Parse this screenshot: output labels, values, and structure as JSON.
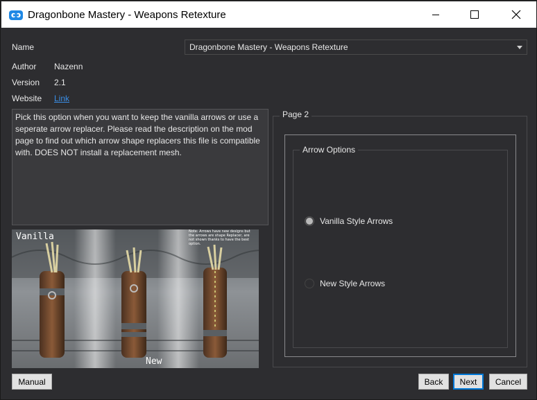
{
  "window": {
    "title": "Dragonbone Mastery - Weapons Retexture",
    "controls": [
      "minimize-icon",
      "maximize-icon",
      "close-icon"
    ]
  },
  "info": {
    "name_label": "Name",
    "name_value": "Dragonbone Mastery - Weapons Retexture",
    "author_label": "Author",
    "author_value": "Nazenn",
    "version_label": "Version",
    "version_value": "2.1",
    "website_label": "Website",
    "website_link": "Link"
  },
  "description": "Pick this option when you want to keep the vanilla arrows or use a seperate arrow replacer. Please read the description on the mod page to find out which arrow shape replacers this file is compatible with. DOES NOT install a replacement mesh.",
  "preview": {
    "label_vanilla": "Vanilla",
    "label_new": "New",
    "note": "Note: Arrows have new designs but the arrows are shape Replacer, are not shown thanks to have the best option."
  },
  "page": {
    "title": "Page 2",
    "group_title": "Arrow Options",
    "options": [
      {
        "label": "Vanilla Style Arrows",
        "selected": true
      },
      {
        "label": "New Style Arrows",
        "selected": false
      }
    ]
  },
  "buttons": {
    "manual": "Manual",
    "back": "Back",
    "next": "Next",
    "cancel": "Cancel"
  },
  "colors": {
    "background": "#2d2d30",
    "link": "#3a8ee6",
    "default_button_border": "#0078d7"
  }
}
